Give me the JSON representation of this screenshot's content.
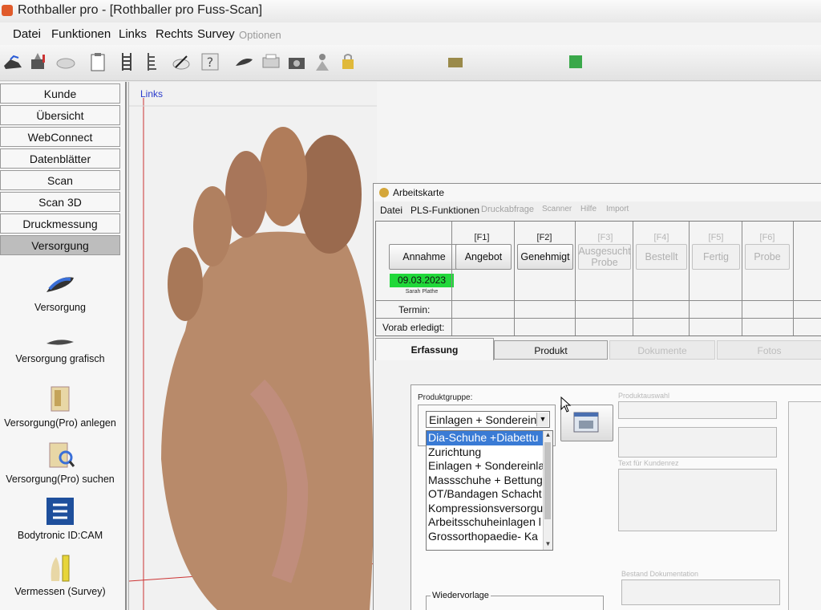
{
  "window": {
    "title": "Rothballer pro - [Rothballer pro Fuss-Scan]"
  },
  "menu": [
    "Datei",
    "Funktionen",
    "Links",
    "Rechts",
    "Survey",
    "Optionen"
  ],
  "toolbar_icons": [
    "shoe-icon",
    "pen-icon",
    "foam-icon",
    "clipboard-icon",
    "ladder-icon",
    "ladder-alt-icon",
    "pen-alt-icon",
    "pencil-icon",
    "help-icon",
    "insole-icon",
    "printer-icon",
    "camera-icon",
    "person-icon",
    "lock-icon"
  ],
  "nav": {
    "items": [
      "Kunde",
      "Übersicht",
      "WebConnect",
      "Datenblätter",
      "Scan",
      "Scan 3D",
      "Druckmessung",
      "Versorgung"
    ],
    "active_index": 7
  },
  "tools": [
    "Versorgung",
    "Versorgung grafisch",
    "Versorgung(Pro) anlegen",
    "Versorgung(Pro) suchen",
    "Bodytronic ID:CAM",
    "Vermessen (Survey)"
  ],
  "viewport": {
    "label": "Links"
  },
  "dialog": {
    "title": "Arbeitskarte",
    "menu": [
      "Datei",
      "PLS-Funktionen",
      "Druckabfrage",
      "Scanner",
      "Hilfe",
      "Import"
    ],
    "status": {
      "annahme": "Annahme",
      "date": "09.03.2023",
      "user": "Sarah Plathe",
      "columns": [
        {
          "key": "[F1]",
          "label": "Angebot"
        },
        {
          "key": "[F2]",
          "label": "Genehmigt"
        },
        {
          "key": "[F3]",
          "label": "Ausgesucht Probe"
        },
        {
          "key": "[F4]",
          "label": "Bestellt"
        },
        {
          "key": "[F5]",
          "label": "Fertig"
        },
        {
          "key": "[F6]",
          "label": "Probe"
        }
      ],
      "termin_label": "Termin:",
      "vorab_label": "Vorab erledigt:"
    },
    "tabs": [
      "Erfassung",
      "Produkt",
      "Dokumente",
      "Fotos"
    ],
    "active_tab": 0,
    "form": {
      "produktgruppe_label": "Produktgruppe:",
      "selected": "Einlagen + Sondereinl",
      "options": [
        "Dia-Schuhe +Diabettu",
        "Zurichtung",
        "Einlagen + Sondereinla",
        "Massschuhe + Bettung",
        "OT/Bandagen Schacht",
        "Kompressionsversorgu",
        "Arbeitsschuheinlagen l",
        "Grossorthopaedie- Ka"
      ],
      "highlighted_index": 0,
      "produktauswahl_label": "Produktauswahl",
      "text_label": "Text für Kundenrez",
      "bestand_label": "Bestand Dokumentation",
      "wiedervorlage_label": "Wiedervorlage"
    }
  }
}
